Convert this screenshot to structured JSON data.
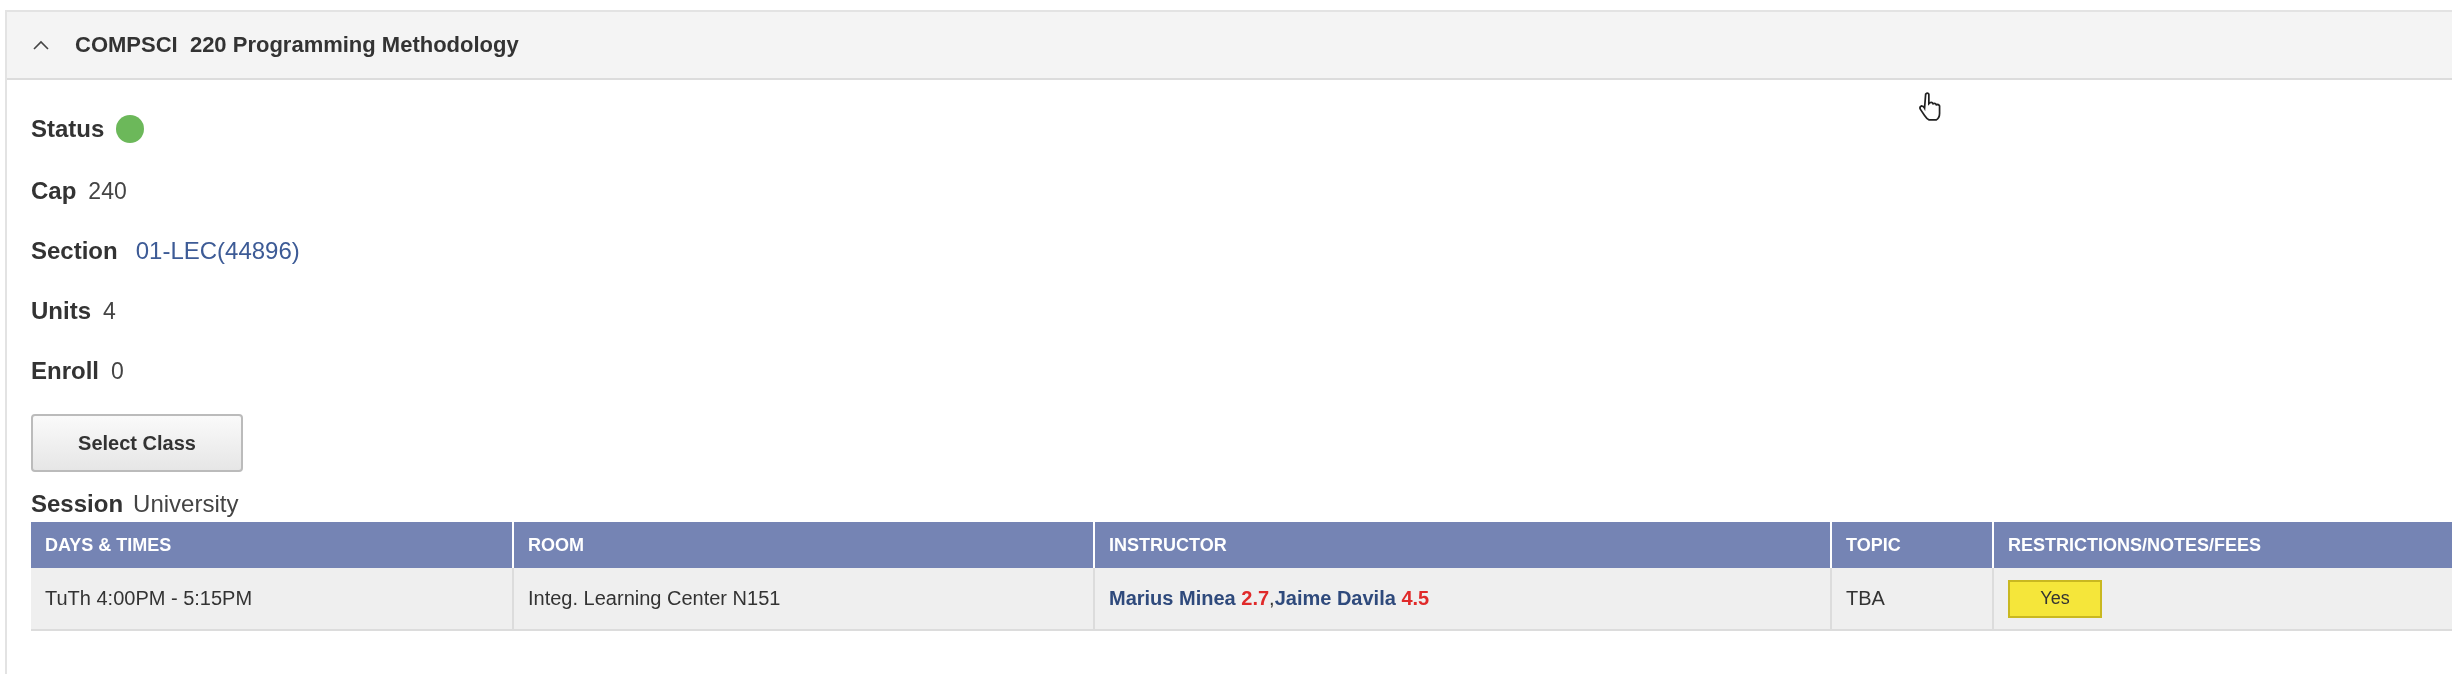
{
  "panel": {
    "title": "COMPSCI  220 Programming Methodology",
    "expanded": true
  },
  "fields": [
    {
      "kind": "dot",
      "label": "Status",
      "color": "#6cb85a"
    },
    {
      "kind": "text",
      "label": "Cap",
      "value": "240"
    },
    {
      "kind": "link",
      "label": "Section",
      "value": "01-LEC(44896)"
    },
    {
      "kind": "text",
      "label": "Units",
      "value": "4"
    },
    {
      "kind": "text",
      "label": "Enroll",
      "value": "0"
    }
  ],
  "select_button": "Select Class",
  "session": {
    "label": "Session",
    "value": "University"
  },
  "table": {
    "columns": [
      "DAYS & TIMES",
      "ROOM",
      "INSTRUCTOR",
      "TOPIC",
      "RESTRICTIONS/NOTES/FEES"
    ],
    "rows": [
      {
        "days_times": "TuTh 4:00PM - 5:15PM",
        "room": "Integ. Learning Center N151",
        "instructors": [
          {
            "name": "Marius Minea",
            "rating": "2.7"
          },
          {
            "name": "Jaime Davila",
            "rating": "4.5"
          }
        ],
        "separator": ",",
        "topic": "TBA",
        "restrictions": "Yes"
      }
    ]
  }
}
